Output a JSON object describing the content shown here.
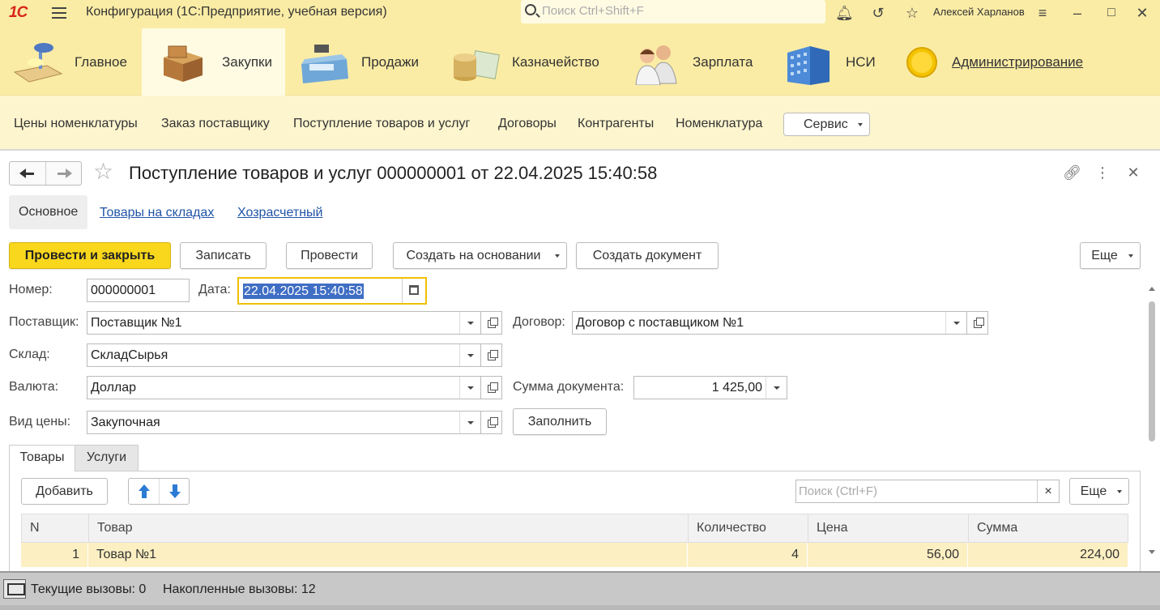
{
  "titlebar": {
    "logo": "1С",
    "title": "Конфигурация  (1С:Предприятие, учебная версия)",
    "search_placeholder": "Поиск Ctrl+Shift+F",
    "user": "Алексей Харланов"
  },
  "sections": [
    {
      "label": "Главное",
      "icon": "desk-lamp-icon"
    },
    {
      "label": "Закупки",
      "icon": "boxes-icon",
      "active": true
    },
    {
      "label": "Продажи",
      "icon": "cash-register-icon"
    },
    {
      "label": "Казначейство",
      "icon": "coins-icon"
    },
    {
      "label": "Зарплата",
      "icon": "staff-icon"
    },
    {
      "label": "НСИ",
      "icon": "building-icon"
    },
    {
      "label": "Администрирование",
      "icon": "gear-disc-icon",
      "underline": true
    }
  ],
  "commands": {
    "links": [
      "Цены номенклатуры",
      "Заказ поставщику",
      "Поступление товаров и услуг",
      "Договоры",
      "Контрагенты",
      "Номенклатура"
    ],
    "service": "Сервис"
  },
  "form": {
    "title": "Поступление товаров и услуг 000000001 от 22.04.2025 15:40:58",
    "panel_tabs": [
      "Основное",
      "Товары на складах",
      "Хозрасчетный"
    ],
    "toolbar": {
      "post_close": "Провести и закрыть",
      "save": "Записать",
      "post": "Провести",
      "create_based": "Создать на основании",
      "create_doc": "Создать документ",
      "more": "Еще"
    },
    "fields": {
      "number_label": "Номер:",
      "number": "000000001",
      "date_label": "Дата:",
      "date": "22.04.2025 15:40:58",
      "supplier_label": "Поставщик:",
      "supplier": "Поставщик №1",
      "contract_label": "Договор:",
      "contract": "Договор с поставщиком №1",
      "warehouse_label": "Склад:",
      "warehouse": "СкладСырья",
      "currency_label": "Валюта:",
      "currency": "Доллар",
      "amount_label": "Сумма документа:",
      "amount": "1 425,00",
      "price_type_label": "Вид цены:",
      "price_type": "Закупочная",
      "fill": "Заполнить"
    },
    "tabs": [
      "Товары",
      "Услуги"
    ],
    "table_toolbar": {
      "add": "Добавить",
      "search_placeholder": "Поиск (Ctrl+F)",
      "clear": "×",
      "more": "Еще"
    },
    "table": {
      "columns": [
        "N",
        "Товар",
        "Количество",
        "Цена",
        "Сумма"
      ],
      "rows": [
        {
          "n": "1",
          "item": "Товар №1",
          "qty": "4",
          "price": "56,00",
          "sum": "224,00"
        }
      ]
    }
  },
  "statusbar": {
    "current": "Текущие вызовы: 0",
    "accumulated": "Накопленные вызовы: 12"
  }
}
